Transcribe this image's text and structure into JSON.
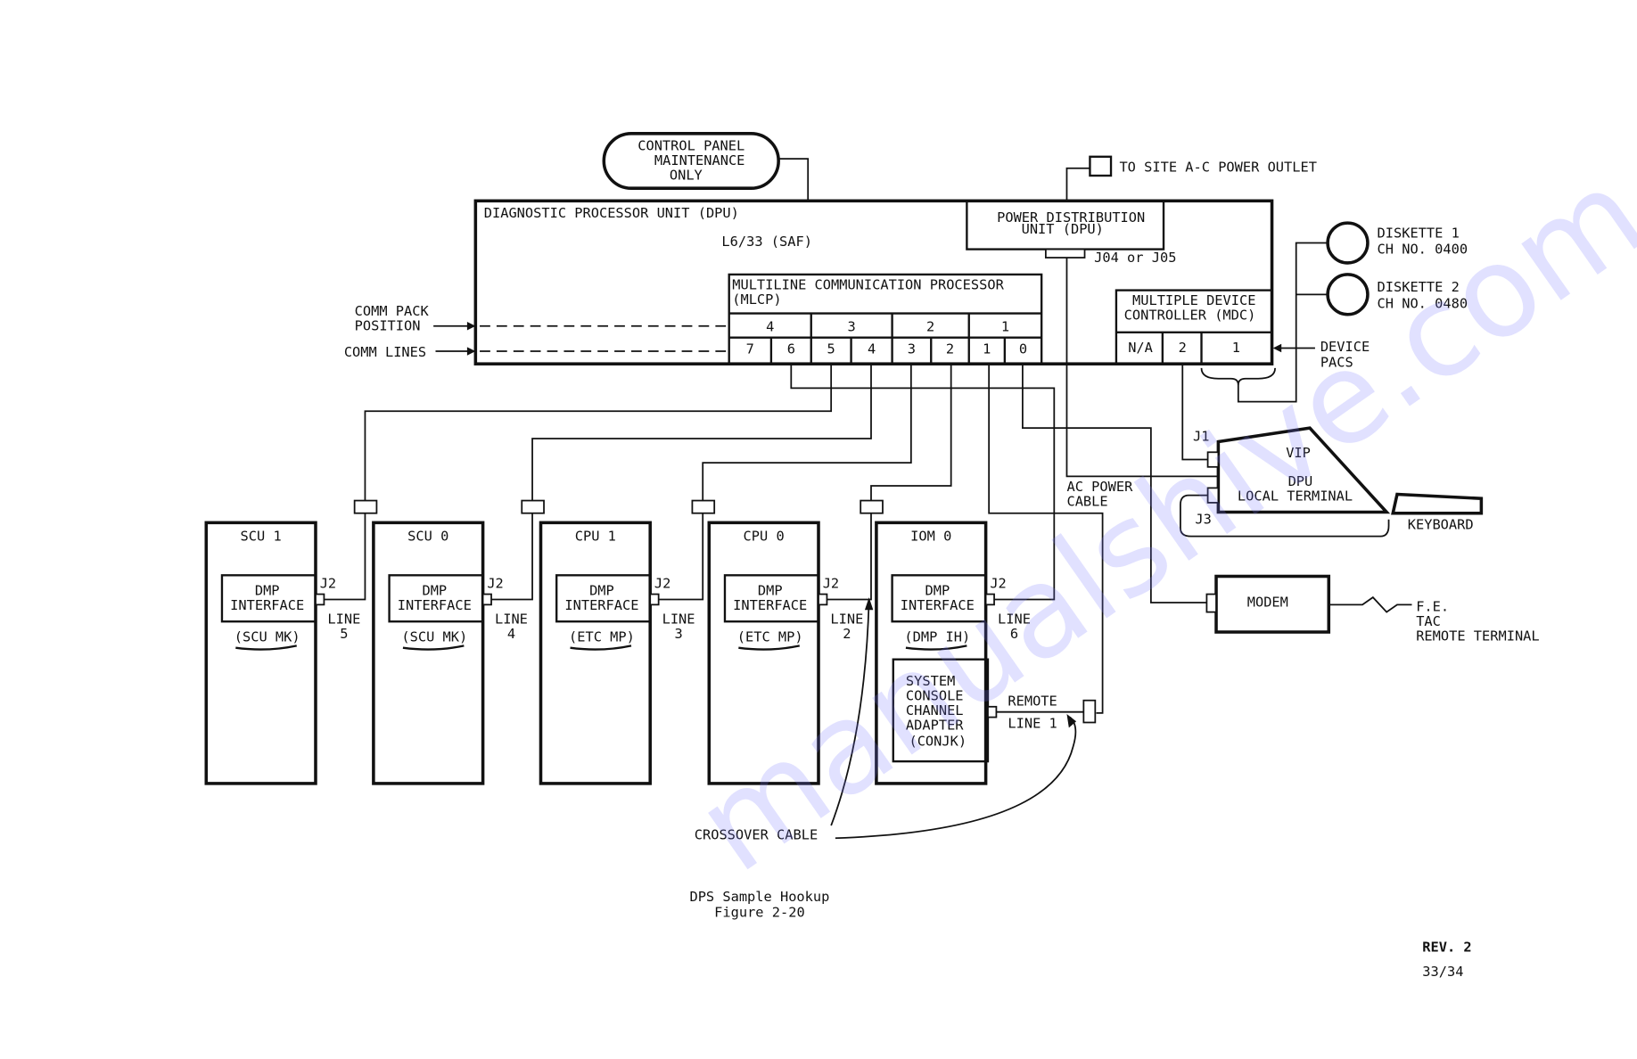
{
  "control_panel": {
    "lines": [
      "CONTROL PANEL",
      "MAINTENANCE",
      "ONLY"
    ]
  },
  "power_outlet_label": "TO SITE A-C POWER OUTLET",
  "dpu": {
    "title": "DIAGNOSTIC PROCESSOR UNIT (DPU)",
    "model": "L6/33 (SAF)",
    "power_unit": {
      "lines": [
        "POWER DISTRIBUTION",
        "UNIT (DPU)"
      ]
    },
    "power_connector": "J04 or J05",
    "mlcp": {
      "lines": [
        "MULTILINE COMMUNICATION PROCESSOR",
        "(MLCP)"
      ],
      "packs": [
        "4",
        "3",
        "2",
        "1"
      ],
      "lines_nums": [
        "7",
        "6",
        "5",
        "4",
        "3",
        "2",
        "1",
        "0"
      ]
    },
    "mdc": {
      "lines": [
        "MULTIPLE DEVICE",
        "CONTROLLER (MDC)"
      ],
      "slots": [
        "N/A",
        "2",
        "1"
      ]
    }
  },
  "left_labels": {
    "comm_pack": [
      "COMM PACK",
      "POSITION"
    ],
    "comm_lines": "COMM LINES"
  },
  "diskettes": [
    {
      "lines": [
        "DISKETTE 1",
        "CH NO. 0400"
      ]
    },
    {
      "lines": [
        "DISKETTE 2",
        "CH NO. 0480"
      ]
    }
  ],
  "device_pacs": [
    "DEVICE",
    "PACS"
  ],
  "vip": {
    "lines": [
      "VIP",
      "DPU",
      "LOCAL TERMINAL"
    ],
    "j1": "J1",
    "j3": "J3"
  },
  "keyboard": "KEYBOARD",
  "ac_power_cable": [
    "AC POWER",
    "CABLE"
  ],
  "modem": "MODEM",
  "fe_terminal": [
    "F.E.",
    "TAC",
    "REMOTE TERMINAL"
  ],
  "units": [
    {
      "title": "SCU 1",
      "iface": [
        "DMP",
        "INTERFACE"
      ],
      "sub": "(SCU MK)",
      "jack": "J2",
      "line": [
        "LINE",
        "5"
      ]
    },
    {
      "title": "SCU 0",
      "iface": [
        "DMP",
        "INTERFACE"
      ],
      "sub": "(SCU MK)",
      "jack": "J2",
      "line": [
        "LINE",
        "4"
      ]
    },
    {
      "title": "CPU 1",
      "iface": [
        "DMP",
        "INTERFACE"
      ],
      "sub": "(ETC MP)",
      "jack": "J2",
      "line": [
        "LINE",
        "3"
      ]
    },
    {
      "title": "CPU 0",
      "iface": [
        "DMP",
        "INTERFACE"
      ],
      "sub": "(ETC MP)",
      "jack": "J2",
      "line": [
        "LINE",
        "2"
      ]
    },
    {
      "title": "IOM 0",
      "iface": [
        "DMP",
        "INTERFACE"
      ],
      "sub": "(DMP IH)",
      "jack": "J2",
      "line": [
        "LINE",
        "6"
      ]
    }
  ],
  "sys_console": {
    "lines": [
      "SYSTEM",
      "CONSOLE",
      "CHANNEL",
      "ADAPTER",
      "(CONJK)"
    ]
  },
  "remote_line": [
    "REMOTE",
    "LINE 1"
  ],
  "crossover_cable": "CROSSOVER CABLE",
  "caption": [
    "DPS Sample Hookup",
    "Figure 2-20"
  ],
  "revision": "REV. 2",
  "page_number": "33/34",
  "watermark": "manualshive.com"
}
